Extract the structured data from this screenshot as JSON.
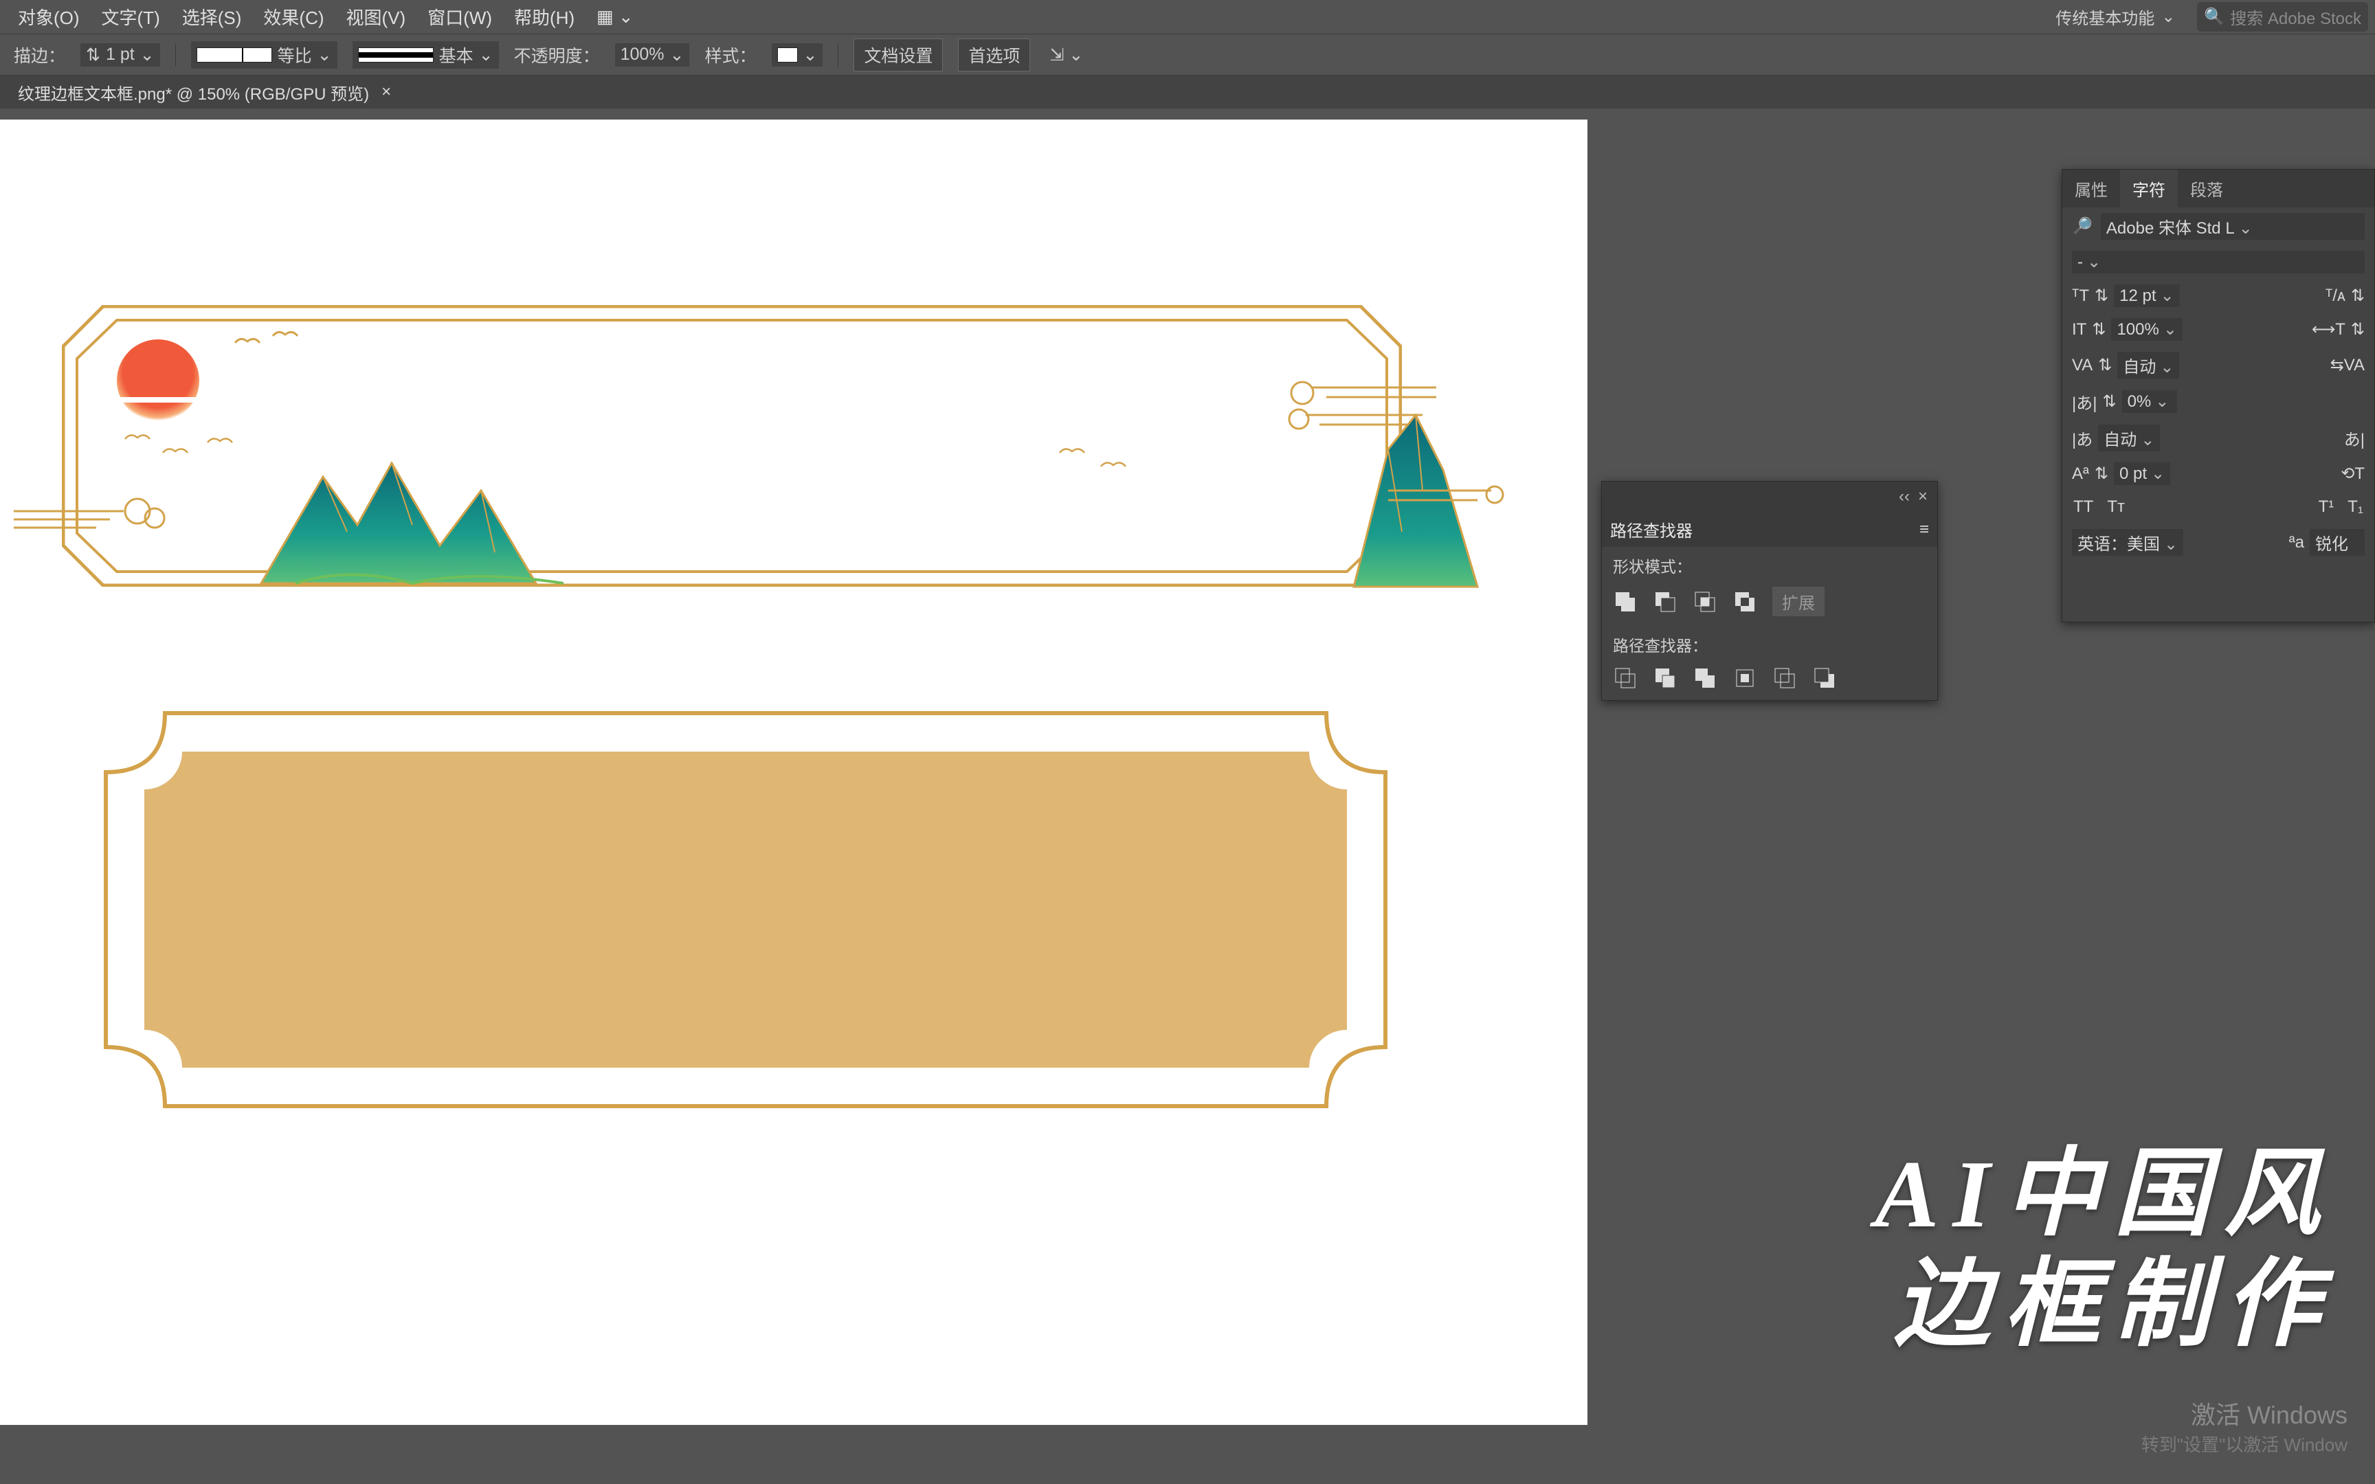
{
  "menu": {
    "items": [
      "对象(O)",
      "文字(T)",
      "选择(S)",
      "效果(C)",
      "视图(V)",
      "窗口(W)",
      "帮助(H)"
    ],
    "workspace": "传统基本功能",
    "search_placeholder": "搜索 Adobe Stock"
  },
  "options": {
    "stroke_label": "描边：",
    "stroke_width": "1 pt",
    "dash_label": "等比",
    "profile_label": "基本",
    "opacity_label": "不透明度：",
    "opacity_value": "100%",
    "style_label": "样式：",
    "doc_setup": "文档设置",
    "prefs": "首选项"
  },
  "tab": {
    "title": "纹理边框文本框.png* @ 150% (RGB/GPU 预览)"
  },
  "pathfinder": {
    "title": "路径查找器",
    "shape_modes": "形状模式：",
    "expand": "扩展",
    "pathfinders": "路径查找器："
  },
  "charpanel": {
    "tabs": [
      "属性",
      "字符",
      "段落"
    ],
    "font_family": "Adobe 宋体 Std L",
    "font_style": "-",
    "font_size": "12 pt",
    "leading_auto": "自动",
    "horiz_scale": "100%",
    "tracking": "0%",
    "kerning": "自动",
    "baseline": "0 pt",
    "lang_label": "英语：美国",
    "aa_label": "锐化"
  },
  "caption": {
    "line1": "AI中国风",
    "line2": "边框制作"
  },
  "watermark": {
    "line1": "激活 Windows",
    "line2": "转到\"设置\"以激活 Window"
  }
}
